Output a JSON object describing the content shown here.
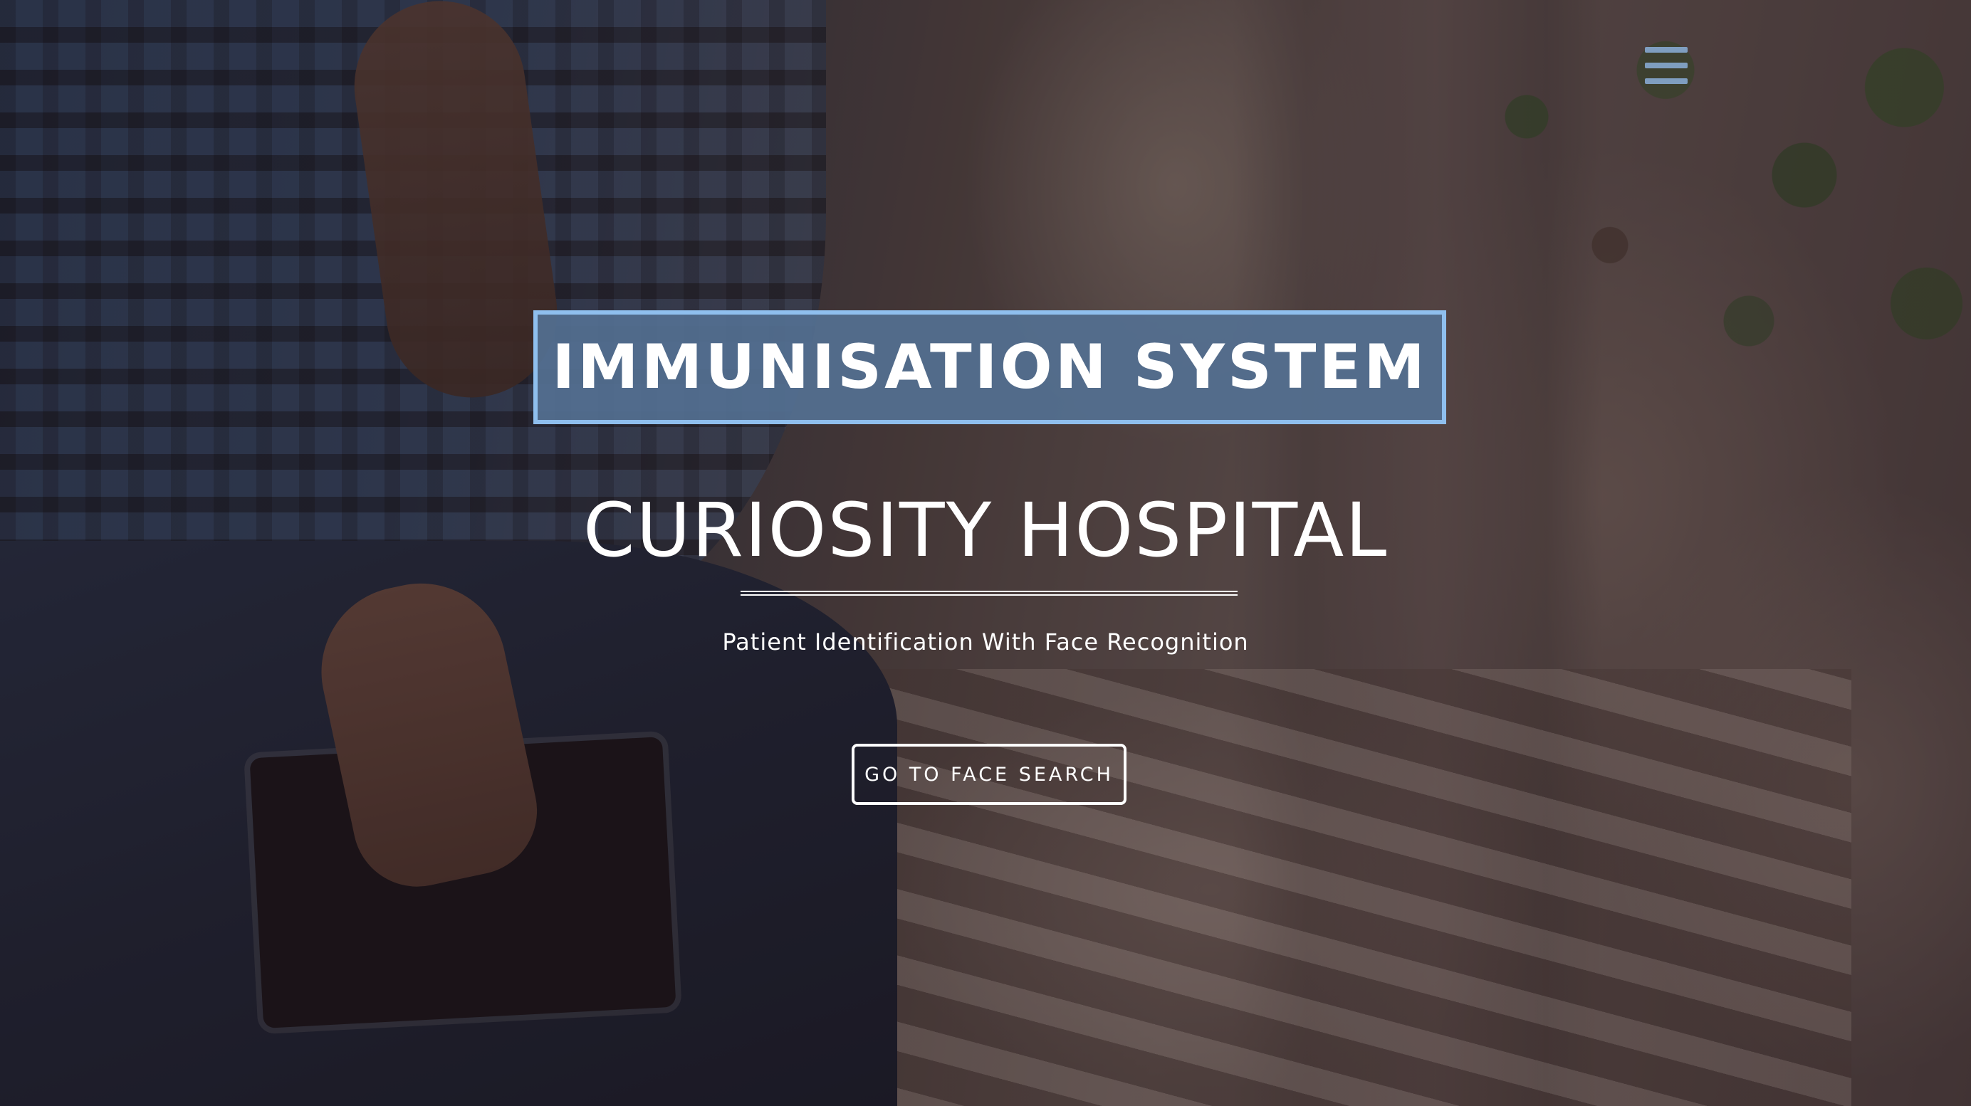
{
  "hero": {
    "title": "IMMUNISATION SYSTEM",
    "subtitle": "CURIOSITY HOSPITAL",
    "tagline": "Patient Identification With Face Recognition",
    "cta_label": "GO TO FACE SEARCH"
  },
  "nav": {
    "menu_icon": "hamburger-menu-icon"
  },
  "colors": {
    "title_box_bg": "#547091",
    "title_box_border": "#8fbfee",
    "menu_icon": "#7f9ec0",
    "text": "#ffffff"
  }
}
